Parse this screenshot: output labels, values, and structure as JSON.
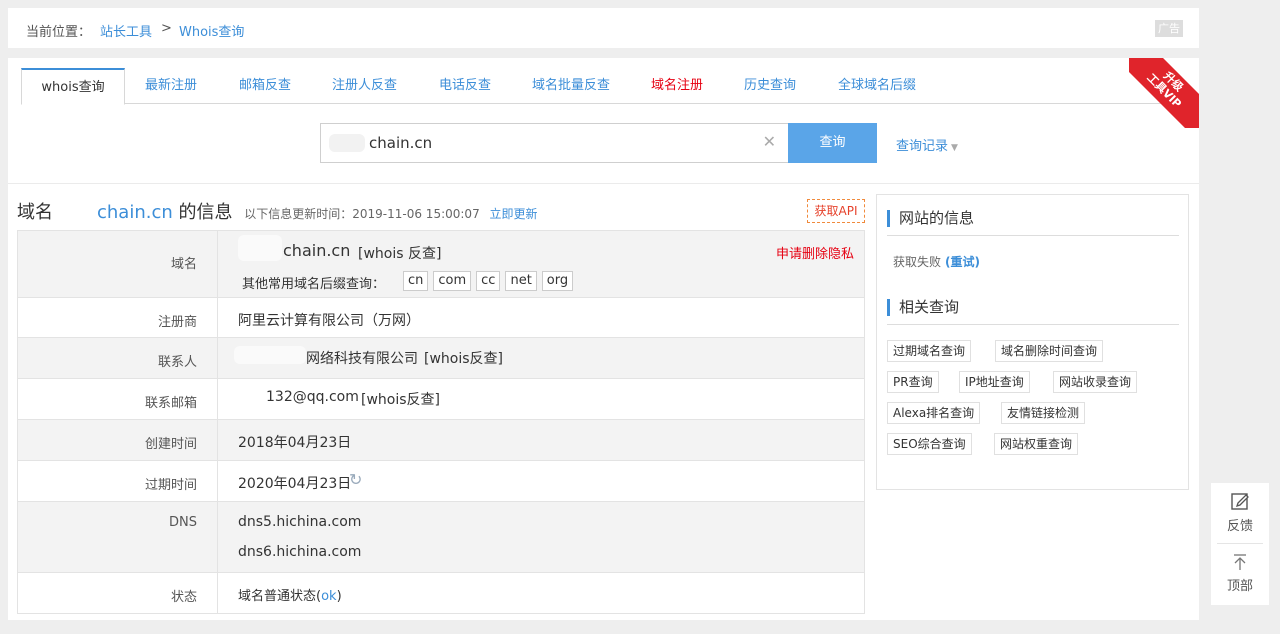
{
  "breadcrumb": {
    "prefix": "当前位置：",
    "home": "站长工具",
    "sep": ">",
    "current": "Whois查询",
    "ad": "广告"
  },
  "tabs": [
    {
      "label": "whois查询"
    },
    {
      "label": "最新注册"
    },
    {
      "label": "邮箱反查"
    },
    {
      "label": "注册人反查"
    },
    {
      "label": "电话反查"
    },
    {
      "label": "域名批量反查"
    },
    {
      "label": "域名注册"
    },
    {
      "label": "历史查询"
    },
    {
      "label": "全球域名后缀"
    }
  ],
  "vip": {
    "line1": "升级",
    "line2": "工具VIP"
  },
  "search": {
    "value": "chain.cn",
    "button": "查询",
    "history": "查询记录"
  },
  "info": {
    "title_prefix": "域名",
    "domain": "chain.cn",
    "title_suffix": "的信息",
    "update_label": "以下信息更新时间：2019-11-06 15:00:07",
    "update_link": "立即更新",
    "api": "获取API"
  },
  "table": {
    "domain_label": "域名",
    "domain_value": "chain.cn",
    "whois_link": "[whois 反查]",
    "privacy": "申请删除隐私",
    "suffix_label": "其他常用域名后缀查询：",
    "suffixes": [
      "cn",
      "com",
      "cc",
      "net",
      "org"
    ],
    "registrar_label": "注册商",
    "registrar_value": "阿里云计算有限公司（万网）",
    "contact_label": "联系人",
    "contact_value": "网络科技有限公司",
    "contact_link": "[whois反查]",
    "email_label": "联系邮箱",
    "email_value": "132@qq.com",
    "email_link": "[whois反查]",
    "created_label": "创建时间",
    "created_value": "2018年04月23日",
    "expire_label": "过期时间",
    "expire_value": "2020年04月23日",
    "dns_label": "DNS",
    "dns1": "dns5.hichina.com",
    "dns2": "dns6.hichina.com",
    "status_label": "状态",
    "status_prefix": "域名普通状态(",
    "status_link": "ok",
    "status_suffix": ")"
  },
  "side": {
    "site_info_title": "网站的信息",
    "fail_text": "获取失败",
    "retry": "(重试)",
    "related_title": "相关查询",
    "chips": [
      "过期域名查询",
      "域名删除时间查询",
      "PR查询",
      "IP地址查询",
      "网站收录查询",
      "Alexa排名查询",
      "友情链接检测",
      "SEO综合查询",
      "网站权重查询"
    ]
  },
  "float": {
    "feedback": "反馈",
    "top": "顶部"
  },
  "colors": {
    "accent": "#3c8ed8",
    "red": "#e60012",
    "button": "#5aa5e8"
  }
}
